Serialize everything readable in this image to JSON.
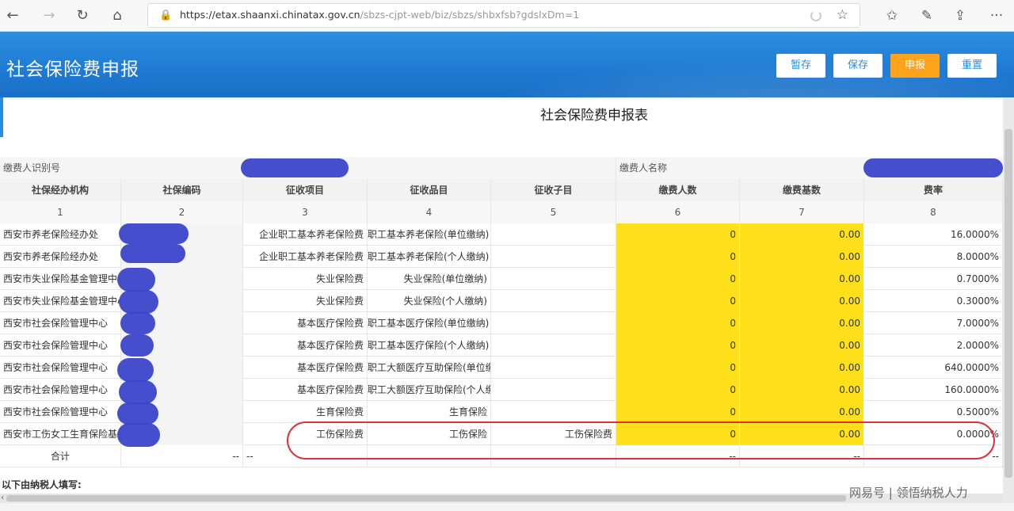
{
  "browser": {
    "url_main": "https://etax.shaanxi.chinatax.gov.cn",
    "url_rest": "/sbzs-cjpt-web/biz/sbzs/shbxfsb?gdslxDm=1"
  },
  "header": {
    "title": "社会保险费申报",
    "buttons": {
      "save_temp": "暂存",
      "save": "保存",
      "submit": "申报",
      "reset": "重置"
    }
  },
  "form": {
    "title": "社会保险费申报表",
    "payer_id_label": "缴费人识别号",
    "payer_name_label": "缴费人名称",
    "columns": [
      "社保经办机构",
      "社保编码",
      "征收项目",
      "征收品目",
      "征收子目",
      "缴费人数",
      "缴费基数",
      "费率"
    ],
    "column_numbers": [
      "1",
      "2",
      "3",
      "4",
      "5",
      "6",
      "7",
      "8"
    ],
    "rows": [
      {
        "agency": "西安市养老保险经办处",
        "item": "企业职工基本养老保险费",
        "category": "职工基本养老保险(单位缴纳)",
        "sub": "",
        "persons": "0",
        "base": "0.00",
        "rate": "16.0000%"
      },
      {
        "agency": "西安市养老保险经办处",
        "item": "企业职工基本养老保险费",
        "category": "职工基本养老保险(个人缴纳)",
        "sub": "",
        "persons": "0",
        "base": "0.00",
        "rate": "8.0000%"
      },
      {
        "agency": "西安市失业保险基金管理中心",
        "item": "失业保险费",
        "category": "失业保险(单位缴纳)",
        "sub": "",
        "persons": "0",
        "base": "0.00",
        "rate": "0.7000%"
      },
      {
        "agency": "西安市失业保险基金管理中心",
        "item": "失业保险费",
        "category": "失业保险(个人缴纳)",
        "sub": "",
        "persons": "0",
        "base": "0.00",
        "rate": "0.3000%"
      },
      {
        "agency": "西安市社会保险管理中心",
        "item": "基本医疗保险费",
        "category": "职工基本医疗保险(单位缴纳)",
        "sub": "",
        "persons": "0",
        "base": "0.00",
        "rate": "7.0000%"
      },
      {
        "agency": "西安市社会保险管理中心",
        "item": "基本医疗保险费",
        "category": "职工基本医疗保险(个人缴纳)",
        "sub": "",
        "persons": "0",
        "base": "0.00",
        "rate": "2.0000%"
      },
      {
        "agency": "西安市社会保险管理中心",
        "item": "基本医疗保险费",
        "category": "职工大额医疗互助保险(单位缴",
        "sub": "",
        "persons": "0",
        "base": "0.00",
        "rate": "640.0000%"
      },
      {
        "agency": "西安市社会保险管理中心",
        "item": "基本医疗保险费",
        "category": "职工大额医疗互助保险(个人缴",
        "sub": "",
        "persons": "0",
        "base": "0.00",
        "rate": "160.0000%"
      },
      {
        "agency": "西安市社会保险管理中心",
        "item": "生育保险费",
        "category": "生育保险",
        "sub": "",
        "persons": "0",
        "base": "0.00",
        "rate": "0.5000%"
      },
      {
        "agency": "西安市工伤女工生育保险基金",
        "item": "工伤保险费",
        "category": "工伤保险",
        "sub": "工伤保险费",
        "persons": "0",
        "base": "0.00",
        "rate": "0.0000%"
      }
    ],
    "total_label": "合计",
    "dash": "--",
    "footer_label": "以下由纳税人填写:"
  },
  "watermark": "网易号 | 领悟纳税人力"
}
